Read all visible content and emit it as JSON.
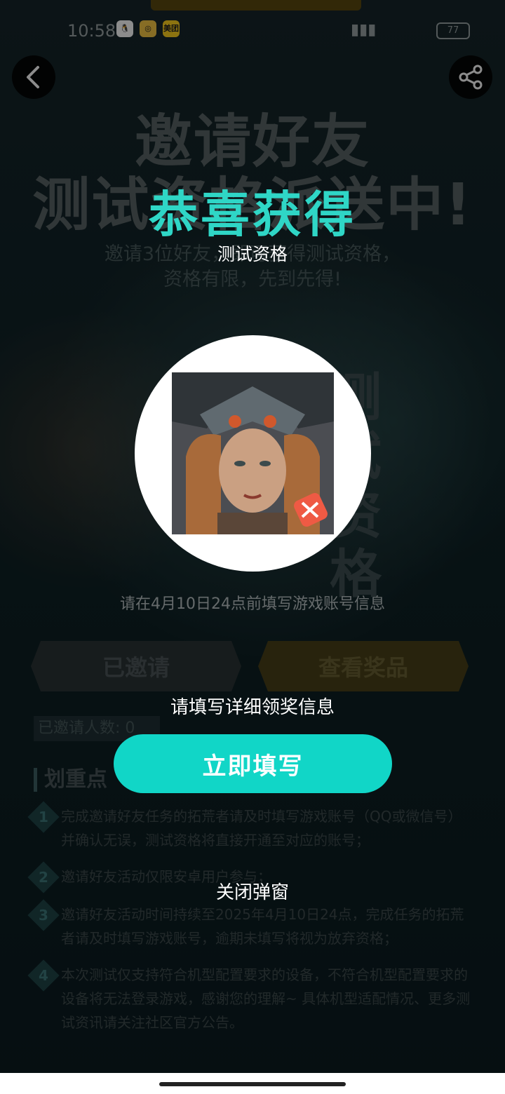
{
  "status_bar": {
    "time": "10:58",
    "apps": [
      "QQ",
      "微博",
      "美团"
    ],
    "battery": "77"
  },
  "page": {
    "hero": {
      "title_line1": "邀请好友",
      "title_line2": "测试资格派送中!",
      "sub_line1": "邀请3位好友，即可获得测试资格，",
      "sub_line2": "资格有限，先到先得!",
      "badge": "测试资格"
    },
    "deadline_note": "请在4月10日24点前填写游戏账号信息",
    "tabs": {
      "invited": "已邀请",
      "view_prize": "查看奖品"
    },
    "invited_count_label": "已邀请人数: 0",
    "rules": {
      "title": "划重点",
      "items": [
        {
          "num": "1",
          "text": "完成邀请好友任务的拓荒者请及时填写游戏账号（QQ或微信号）并确认无误，测试资格将直接开通至对应的账号；"
        },
        {
          "num": "2",
          "text": "邀请好友活动仅限安卓用户参与；"
        },
        {
          "num": "3",
          "text": "邀请好友活动时间持续至2025年4月10日24点，完成任务的拓荒者请及时填写游戏账号，逾期未填写将视为放弃资格；"
        },
        {
          "num": "4",
          "text": "本次测试仅支持符合机型配置要求的设备，不符合机型配置要求的设备将无法登录游戏，感谢您的理解~ 具体机型适配情况、更多测试资讯请关注社区官方公告。"
        }
      ]
    }
  },
  "popup": {
    "title": "恭喜获得",
    "prize_name": "测试资格",
    "hint": "请填写详细领奖信息",
    "fill_button": "立即填写",
    "close_label": "关闭弹窗"
  },
  "colors": {
    "accent": "#11d6c7",
    "title": "#2fd6c6"
  }
}
